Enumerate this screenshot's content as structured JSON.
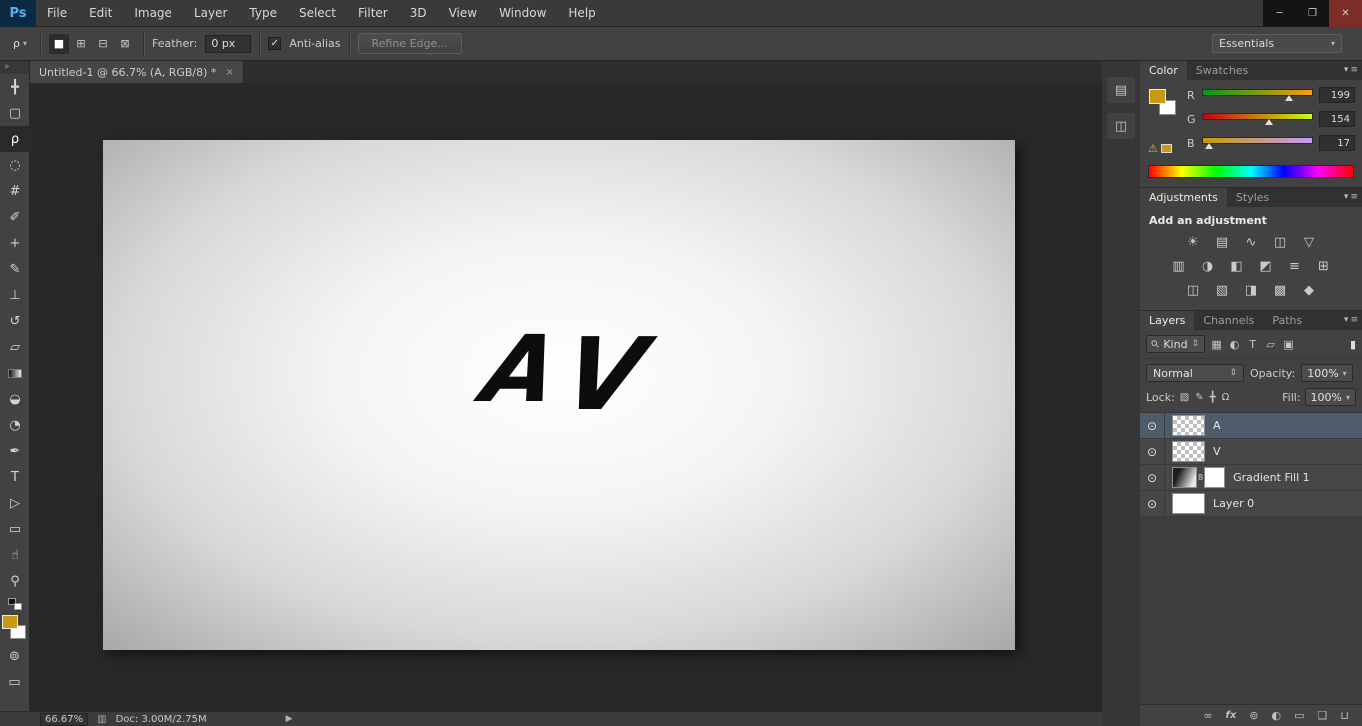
{
  "window": {
    "minimize": "─",
    "restore": "❐",
    "close": "✕"
  },
  "menu_bar": {
    "logo": "Ps",
    "items": [
      "File",
      "Edit",
      "Image",
      "Layer",
      "Type",
      "Select",
      "Filter",
      "3D",
      "View",
      "Window",
      "Help"
    ]
  },
  "options_bar": {
    "tool_glyph": "ρ",
    "dropdown_arrow": "▾",
    "mode_icons": [
      {
        "name": "new-selection",
        "glyph": "■"
      },
      {
        "name": "add-to-selection",
        "glyph": "⊞"
      },
      {
        "name": "subtract-from-selection",
        "glyph": "⊟"
      },
      {
        "name": "intersect-selection",
        "glyph": "⊠"
      }
    ],
    "feather_label": "Feather:",
    "feather_value": "0 px",
    "anti_alias_check": "✓",
    "anti_alias_label": "Anti-alias",
    "refine_edge_label": "Refine Edge...",
    "workspace_label": "Essentials",
    "workspace_arrow": "▾"
  },
  "toolbar": {
    "collapse": "»",
    "foreground_color": "#c79a11",
    "background_color": "#ffffff",
    "tools": [
      {
        "name": "move-tool",
        "glyph": "╋"
      },
      {
        "name": "rectangular-marquee-tool",
        "glyph": "▢"
      },
      {
        "name": "polygonal-lasso-tool",
        "glyph": "ρ",
        "selected": true
      },
      {
        "name": "quick-selection-tool",
        "glyph": "◌"
      },
      {
        "name": "crop-tool",
        "glyph": "#"
      },
      {
        "name": "eyedropper-tool",
        "glyph": "✐"
      },
      {
        "name": "spot-healing-brush-tool",
        "glyph": "+"
      },
      {
        "name": "brush-tool",
        "glyph": "✎"
      },
      {
        "name": "clone-stamp-tool",
        "glyph": "⊥"
      },
      {
        "name": "history-brush-tool",
        "glyph": "↺"
      },
      {
        "name": "eraser-tool",
        "glyph": "▱"
      },
      {
        "name": "gradient-tool",
        "glyph": ""
      },
      {
        "name": "blur-tool",
        "glyph": "◒"
      },
      {
        "name": "dodge-tool",
        "glyph": "◔"
      },
      {
        "name": "pen-tool",
        "glyph": "✒"
      },
      {
        "name": "type-tool",
        "glyph": "T"
      },
      {
        "name": "path-selection-tool",
        "glyph": "▷"
      },
      {
        "name": "rectangle-tool",
        "glyph": "▭"
      },
      {
        "name": "hand-tool",
        "glyph": "☝"
      },
      {
        "name": "zoom-tool",
        "glyph": "⚲"
      }
    ],
    "quick_mask_glyph": "⊚",
    "screen_mode_glyph": "▭"
  },
  "tab": {
    "title": "Untitled-1 @ 66.7% (A, RGB/8) *",
    "close": "×"
  },
  "canvas": {
    "logo_a": "A",
    "logo_v": "V"
  },
  "status_bar": {
    "zoom": "66.67%",
    "icon": "▥",
    "doc": "Doc: 3.00M/2.75M",
    "arrow": "▶"
  },
  "mini_dock": {
    "icons": [
      {
        "name": "history-panel-icon",
        "glyph": "▤"
      },
      {
        "name": "properties-panel-icon",
        "glyph": "◫"
      }
    ]
  },
  "dock": {
    "panel_menu_arrow": "▾",
    "panel_menu_lines": "≡"
  },
  "color_panel": {
    "tabs": [
      {
        "label": "Color"
      },
      {
        "label": "Swatches"
      }
    ],
    "warning_glyph": "⚠",
    "channels": [
      {
        "label": "R",
        "value": "199",
        "from": "#009a11",
        "to": "#ff9a11"
      },
      {
        "label": "G",
        "value": "154",
        "from": "#c70011",
        "to": "#c7ff11"
      },
      {
        "label": "B",
        "value": "17",
        "from": "#c79a00",
        "to": "#c79aff"
      }
    ]
  },
  "adjustments_panel": {
    "tabs": [
      {
        "label": "Adjustments"
      },
      {
        "label": "Styles"
      }
    ],
    "heading": "Add an adjustment",
    "rows": [
      [
        {
          "name": "brightness-contrast-icon",
          "glyph": "☀"
        },
        {
          "name": "levels-icon",
          "glyph": "▤"
        },
        {
          "name": "curves-icon",
          "glyph": "∿"
        },
        {
          "name": "exposure-icon",
          "glyph": "◫"
        },
        {
          "name": "vibrance-icon",
          "glyph": "▽"
        }
      ],
      [
        {
          "name": "hue-saturation-icon",
          "glyph": "▥"
        },
        {
          "name": "color-balance-icon",
          "glyph": "◑"
        },
        {
          "name": "black-white-icon",
          "glyph": "◧"
        },
        {
          "name": "photo-filter-icon",
          "glyph": "◩"
        },
        {
          "name": "channel-mixer-icon",
          "glyph": "≡"
        },
        {
          "name": "color-lookup-icon",
          "glyph": "⊞"
        }
      ],
      [
        {
          "name": "invert-icon",
          "glyph": "◫"
        },
        {
          "name": "posterize-icon",
          "glyph": "▧"
        },
        {
          "name": "threshold-icon",
          "glyph": "◨"
        },
        {
          "name": "gradient-map-icon",
          "glyph": "▩"
        },
        {
          "name": "selective-color-icon",
          "glyph": "◆"
        }
      ]
    ]
  },
  "layers_panel": {
    "tabs": [
      {
        "label": "Layers"
      },
      {
        "label": "Channels"
      },
      {
        "label": "Paths"
      }
    ],
    "filter": {
      "search_glyph": "⚲",
      "kind_label": "Kind",
      "arrows": "⇕",
      "icons": [
        {
          "name": "pixel-layer-filter-icon",
          "glyph": "▦"
        },
        {
          "name": "adjustment-layer-filter-icon",
          "glyph": "◐"
        },
        {
          "name": "type-layer-filter-icon",
          "glyph": "T"
        },
        {
          "name": "shape-layer-filter-icon",
          "glyph": "▱"
        },
        {
          "name": "smart-object-filter-icon",
          "glyph": "▣"
        }
      ],
      "toggle": "▮"
    },
    "blend": {
      "mode": "Normal",
      "arrows": "⇕",
      "opacity_label": "Opacity:",
      "opacity_value": "100%",
      "arrow": "▾"
    },
    "lock": {
      "label": "Lock:",
      "icons": [
        {
          "name": "lock-transparency-icon",
          "glyph": "▨"
        },
        {
          "name": "lock-pixels-icon",
          "glyph": "✎"
        },
        {
          "name": "lock-position-icon",
          "glyph": "╋"
        },
        {
          "name": "lock-all-icon",
          "glyph": "Ω"
        }
      ],
      "fill_label": "Fill:",
      "fill_value": "100%",
      "fill_arrow": "▾"
    },
    "eye_glyph": "⊙",
    "link_glyph": "8",
    "layers": [
      {
        "name": "A",
        "thumb": "checker",
        "selected": true
      },
      {
        "name": "V",
        "thumb": "checker"
      },
      {
        "name": "Gradient Fill 1",
        "thumb": "gradient",
        "mask": true
      },
      {
        "name": "Layer 0",
        "thumb": "white"
      }
    ],
    "bottom_icons": [
      {
        "name": "link-layers-icon",
        "glyph": "∞"
      },
      {
        "name": "layer-style-icon",
        "glyph": "fx"
      },
      {
        "name": "add-layer-mask-icon",
        "glyph": "⊚"
      },
      {
        "name": "new-adjustment-layer-icon",
        "glyph": "◐"
      },
      {
        "name": "new-group-icon",
        "glyph": "▭"
      },
      {
        "name": "new-layer-icon",
        "glyph": "❏"
      },
      {
        "name": "delete-layer-icon",
        "glyph": "⊔"
      }
    ]
  }
}
